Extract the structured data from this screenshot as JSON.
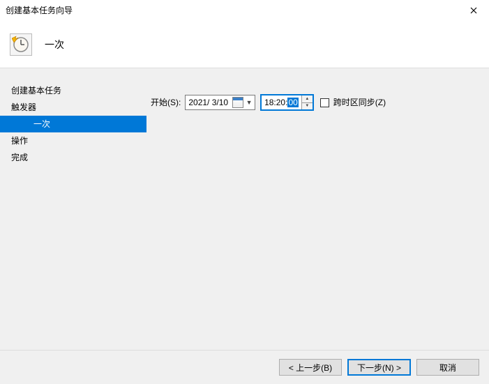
{
  "titlebar": {
    "title": "创建基本任务向导"
  },
  "header": {
    "title": "一次"
  },
  "sidebar": {
    "items": [
      {
        "label": "创建基本任务",
        "indent": false,
        "active": false
      },
      {
        "label": "触发器",
        "indent": false,
        "active": false
      },
      {
        "label": "一次",
        "indent": true,
        "active": true
      },
      {
        "label": "操作",
        "indent": false,
        "active": false
      },
      {
        "label": "完成",
        "indent": false,
        "active": false
      }
    ]
  },
  "form": {
    "start_label": "开始(S):",
    "date_value": "2021/ 3/10",
    "time_prefix": "18:20:",
    "time_selected": "00",
    "sync_label": "跨时区同步(Z)",
    "sync_checked": false
  },
  "footer": {
    "back_label": "< 上一步(B)",
    "next_label": "下一步(N) >",
    "cancel_label": "取消"
  }
}
